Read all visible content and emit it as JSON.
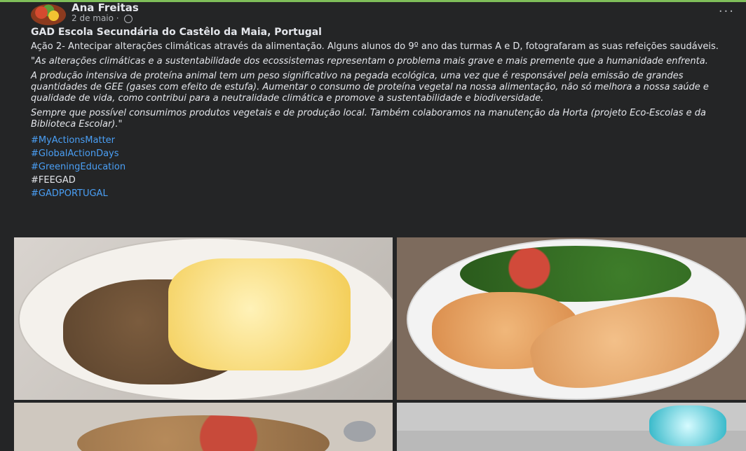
{
  "post": {
    "author": "Ana Freitas",
    "date": "2 de maio · ",
    "more_label": "···",
    "org": "GAD Escola Secundária do Castêlo da Maia, Portugal",
    "paragraphs": [
      "Ação 2- Antecipar alterações climáticas através da alimentação. Alguns alunos do 9º ano das turmas A e D, fotografaram as suas refeições saudáveis.",
      "\"As alterações climáticas e a sustentabilidade dos ecossistemas representam o problema mais grave e mais premente que a humanidade enfrenta.",
      "A produção intensiva de proteína animal tem um peso significativo na pegada ecológica, uma vez que é responsável pela emissão de grandes quantidades de GEE (gases com efeito de estufa). Aumentar o consumo de proteína vegetal na nossa alimentação, não só melhora a nossa saúde e qualidade de vida, como contribui para a neutralidade climática e promove a sustentabilidade e biodiversidade.",
      "Sempre que possível consumimos produtos vegetais e de produção local. Também colaboramos na manutenção da Horta (projeto Eco-Escolas e da Biblioteca Escolar).\""
    ],
    "hashtags": [
      {
        "text": "#MyActionsMatter",
        "link": true
      },
      {
        "text": "#GlobalActionDays",
        "link": true
      },
      {
        "text": "#GreeningEducation",
        "link": true
      },
      {
        "text": "#FEEGAD",
        "link": false
      },
      {
        "text": "#GADPORTUGAL",
        "link": true
      }
    ]
  },
  "colors": {
    "background": "#242526",
    "link": "#4a9ff5",
    "text": "#e4e6eb",
    "accent_bar": "#7fbf5a"
  },
  "icons": {
    "privacy": "globe-icon",
    "menu": "more-options-icon"
  }
}
